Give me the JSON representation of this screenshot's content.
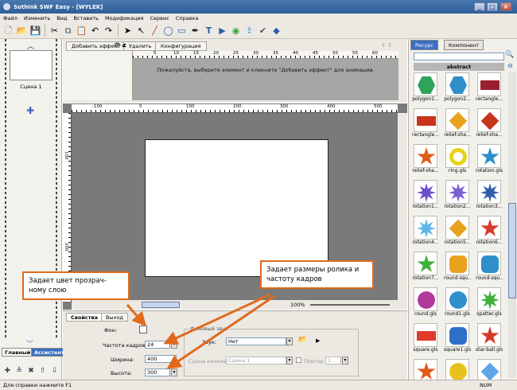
{
  "window": {
    "title": "Sothink SWF Easy - [WYLEK]"
  },
  "menu": [
    "Файл",
    "Изменить",
    "Вид",
    "Вставить",
    "Модификация",
    "Сервис",
    "Справка"
  ],
  "scenes": {
    "scene_label": "Сцена 1",
    "tab_main": "Главный",
    "tab_assistant": "Ассистент"
  },
  "effects": {
    "add_effect": "Добавить эффект ▾",
    "delete": "Удалить",
    "configure": "Конфигурация",
    "message": "Пожалуйста, выберите элемент и кликните \"Добавить эффект\" для анимации.",
    "ruler_ticks": [
      "5",
      "10",
      "15",
      "20",
      "25",
      "30",
      "35",
      "40",
      "45",
      "50",
      "55",
      "60"
    ]
  },
  "stage": {
    "hruler_ticks": [
      "-100",
      "0",
      "100",
      "200",
      "300",
      "400",
      "500"
    ],
    "vruler_ticks": [
      "100",
      "200"
    ],
    "zoom": "100%"
  },
  "properties": {
    "tab_properties": "Свойства",
    "tab_exit": "Выход",
    "bg_label": "Фон:",
    "fps_label": "Частота кадров:",
    "fps_value": "24",
    "width_label": "Ширина:",
    "width_value": "400",
    "height_label": "Высота:",
    "height_value": "300",
    "sound_group": "Фоновый звук",
    "sound_label": "Звук:",
    "sound_value": "Нет",
    "scene_start_label": "Сцена начала:",
    "scene_start_value": "Сцена 1",
    "repeat_label": "Повтор",
    "repeat_value": "1"
  },
  "resource": {
    "tab_resource": "Ресурс",
    "tab_component": "Компонент",
    "category": "abstract",
    "items": [
      {
        "label": "polygon1...",
        "color": "#2fa35a"
      },
      {
        "label": "polygon2...",
        "color": "#2f8fc9"
      },
      {
        "label": "rectangle...",
        "color": "#9a1f2e"
      },
      {
        "label": "rectangle...",
        "color": "#c9351c"
      },
      {
        "label": "relief-sha...",
        "color": "#e8a21c"
      },
      {
        "label": "relief-sha...",
        "color": "#c9351c"
      },
      {
        "label": "relief-sha...",
        "color": "#e05a1a"
      },
      {
        "label": "ring.gls",
        "color": "#e8d21c"
      },
      {
        "label": "rotation.gls",
        "color": "#2f8fc9"
      },
      {
        "label": "rotation1...",
        "color": "#6b4fc9"
      },
      {
        "label": "rotation2...",
        "color": "#7a5fd6"
      },
      {
        "label": "rotation3...",
        "color": "#2f5ea9"
      },
      {
        "label": "rotation4...",
        "color": "#5fb6e6"
      },
      {
        "label": "rotation5...",
        "color": "#e8a21c"
      },
      {
        "label": "rotation6...",
        "color": "#d63a2a"
      },
      {
        "label": "rotation7...",
        "color": "#3fb03a"
      },
      {
        "label": "round-squ...",
        "color": "#e8a21c"
      },
      {
        "label": "round-squ...",
        "color": "#2f8fc9"
      },
      {
        "label": "round.gls",
        "color": "#b03a9a"
      },
      {
        "label": "round1.gls",
        "color": "#2f8fc9"
      },
      {
        "label": "spatter.gls",
        "color": "#3fb03a"
      },
      {
        "label": "square.gls",
        "color": "#e03a2a"
      },
      {
        "label": "square1.gls",
        "color": "#2f6fc9"
      },
      {
        "label": "star-ball.gls",
        "color": "#d63a2a"
      },
      {
        "label": "",
        "color": "#e05a1a"
      },
      {
        "label": "",
        "color": "#e8c21c"
      },
      {
        "label": "",
        "color": "#5fa6e6"
      }
    ]
  },
  "status": {
    "help": "Для справки нажмите F1",
    "num": "NUM"
  },
  "annotations": {
    "color_note": "Задает цвет прозрач- ному слою",
    "size_note": "Задает размеры ролика и частоту кадров",
    "accent": "#e06a1c"
  }
}
